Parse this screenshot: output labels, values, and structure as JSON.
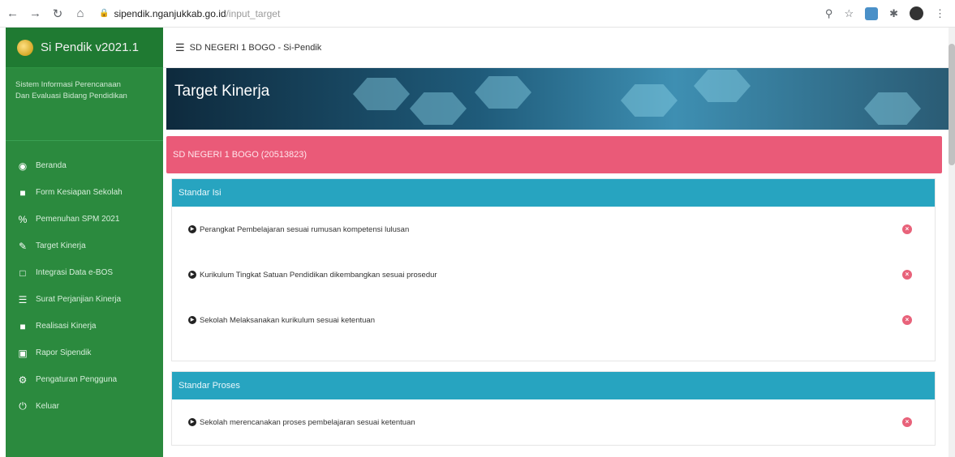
{
  "browser": {
    "url_domain": "sipendik.nganjukkab.go.id",
    "url_path": "/input_target"
  },
  "sidebar": {
    "brand": "Si Pendik v2021.1",
    "subtitle_line1": "Sistem Informasi Perencanaan",
    "subtitle_line2": "Dan Evaluasi Bidang Pendidikan",
    "items": [
      {
        "label": "Beranda",
        "icon": "dashboard-icon"
      },
      {
        "label": "Form Kesiapan Sekolah",
        "icon": "file-icon"
      },
      {
        "label": "Pemenuhan SPM 2021",
        "icon": "percent-icon"
      },
      {
        "label": "Target Kinerja",
        "icon": "edit-icon"
      },
      {
        "label": "Integrasi Data e-BOS",
        "icon": "monitor-icon"
      },
      {
        "label": "Surat Perjanjian Kinerja",
        "icon": "list-icon"
      },
      {
        "label": "Realisasi Kinerja",
        "icon": "file-icon"
      },
      {
        "label": "Rapor Sipendik",
        "icon": "card-icon"
      },
      {
        "label": "Pengaturan Pengguna",
        "icon": "cogs-icon"
      },
      {
        "label": "Keluar",
        "icon": "power-icon"
      }
    ]
  },
  "topbar": {
    "title": "SD NEGERI 1 BOGO  -  Si-Pendik"
  },
  "banner": {
    "title": "Target Kinerja"
  },
  "main": {
    "school": "SD NEGERI 1 BOGO (20513823)",
    "sections": [
      {
        "title": "Standar Isi",
        "rows": [
          "Perangkat Pembelajaran sesuai rumusan kompetensi lulusan",
          "Kurikulum Tingkat Satuan Pendidikan dikembangkan sesuai prosedur",
          "Sekolah Melaksanakan kurikulum sesuai ketentuan"
        ]
      },
      {
        "title": "Standar Proses",
        "rows": [
          "Sekolah merencanakan proses pembelajaran sesuai ketentuan"
        ]
      }
    ]
  },
  "colors": {
    "sidebar": "#2b8a3e",
    "school_bar": "#ea5a78",
    "section_head": "#27a4c0",
    "remove_icon": "#e8627a"
  }
}
